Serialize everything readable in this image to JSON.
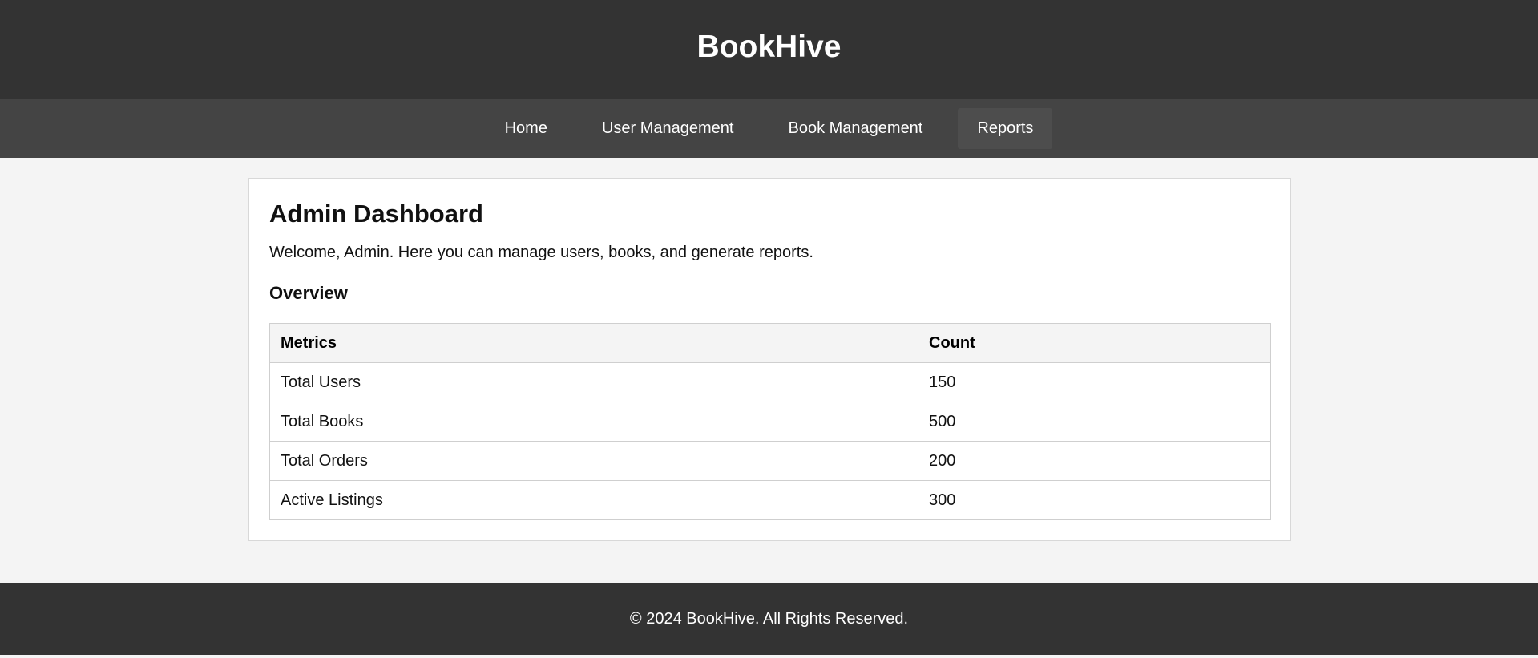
{
  "header": {
    "title": "BookHive"
  },
  "nav": {
    "items": [
      {
        "label": "Home"
      },
      {
        "label": "User Management"
      },
      {
        "label": "Book Management"
      },
      {
        "label": "Reports"
      }
    ]
  },
  "dashboard": {
    "title": "Admin Dashboard",
    "welcome": "Welcome, Admin. Here you can manage users, books, and generate reports.",
    "overview_heading": "Overview",
    "table": {
      "headers": [
        "Metrics",
        "Count"
      ],
      "rows": [
        [
          "Total Users",
          "150"
        ],
        [
          "Total Books",
          "500"
        ],
        [
          "Total Orders",
          "200"
        ],
        [
          "Active Listings",
          "300"
        ]
      ]
    }
  },
  "footer": {
    "text": "© 2024 BookHive. All Rights Reserved."
  },
  "colors": {
    "header_bg": "#333333",
    "nav_bg": "#444444",
    "page_bg": "#f4f4f4",
    "card_bg": "#ffffff"
  }
}
